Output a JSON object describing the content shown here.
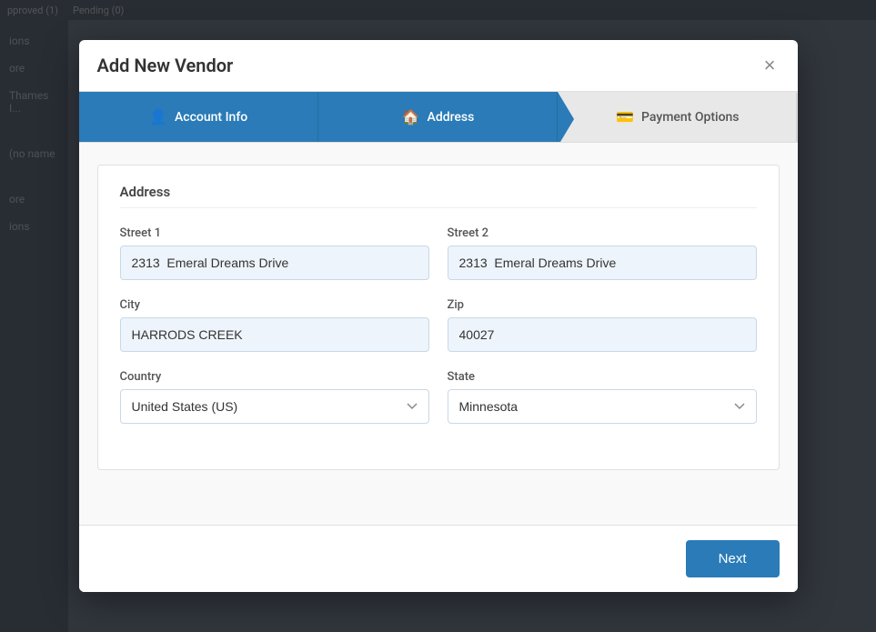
{
  "background": {
    "tabs": [
      "pproved (1)",
      "Pending (0)"
    ],
    "sidebar_items": [
      "ions",
      "ore",
      "ions"
    ]
  },
  "modal": {
    "title": "Add New Vendor",
    "close_label": "×",
    "wizard": {
      "steps": [
        {
          "id": "account-info",
          "label": "Account Info",
          "icon": "👤",
          "state": "completed"
        },
        {
          "id": "address",
          "label": "Address",
          "icon": "🏠",
          "state": "active"
        },
        {
          "id": "payment-options",
          "label": "Payment Options",
          "icon": "💳",
          "state": "inactive"
        }
      ]
    },
    "address_section": {
      "title": "Address",
      "fields": {
        "street1_label": "Street 1",
        "street1_value": "2313  Emeral Dreams Drive",
        "street2_label": "Street 2",
        "street2_value": "2313  Emeral Dreams Drive",
        "city_label": "City",
        "city_value": "HARRODS CREEK",
        "zip_label": "Zip",
        "zip_value": "40027",
        "country_label": "Country",
        "country_value": "United States (US)",
        "state_label": "State",
        "state_value": "Minnesota"
      }
    },
    "footer": {
      "next_label": "Next"
    }
  }
}
